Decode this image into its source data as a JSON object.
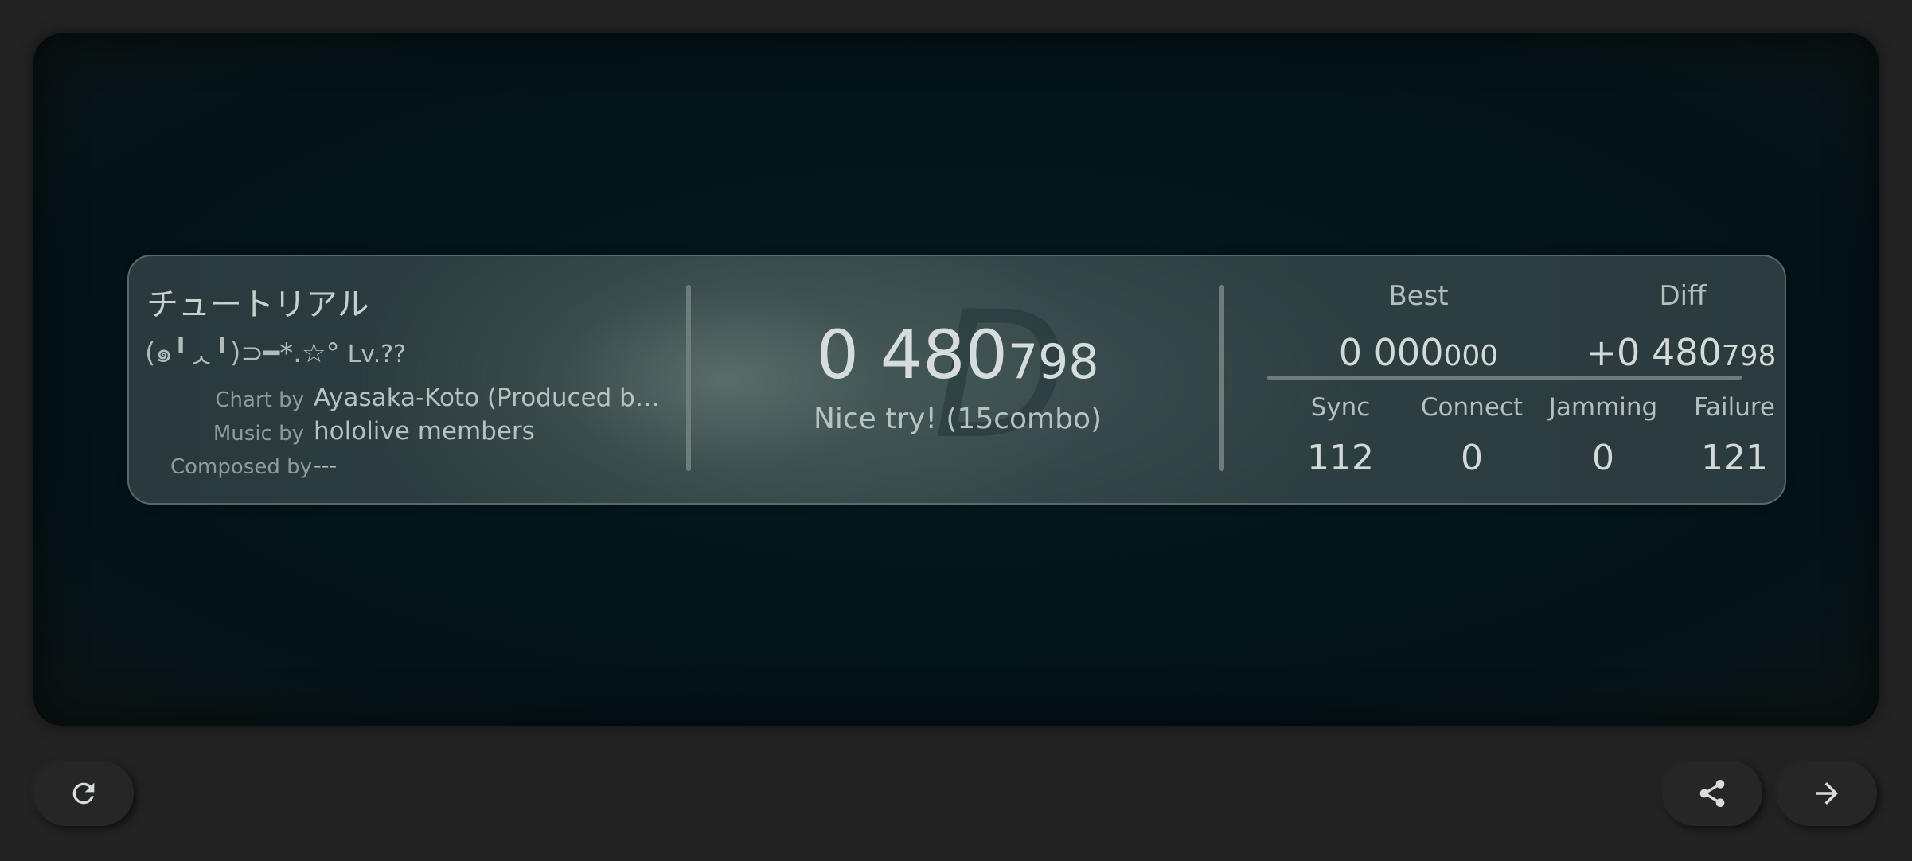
{
  "song": {
    "title": "チュートリアル",
    "artist": "(๑╹ᆺ╹)⊃━*.☆°",
    "level": "Lv.??"
  },
  "credits": [
    {
      "label": "Chart by",
      "value": "Ayasaka-Koto (Produced by ..."
    },
    {
      "label": "Music by",
      "value": "hololive members"
    },
    {
      "label": "Composed by",
      "value": "---"
    }
  ],
  "result": {
    "rank": "D",
    "score_big": "0 480",
    "score_small": "798",
    "message": "Nice try! (15combo)"
  },
  "best": {
    "label": "Best",
    "big": "0 000",
    "small": "000"
  },
  "diff": {
    "label": "Diff",
    "big": "+0 480",
    "small": "798"
  },
  "judgements": [
    {
      "label": "Sync",
      "value": "112"
    },
    {
      "label": "Connect",
      "value": "0"
    },
    {
      "label": "Jamming",
      "value": "0"
    },
    {
      "label": "Failure",
      "value": "121"
    }
  ],
  "buttons": {
    "retry_icon": "refresh-icon",
    "share_icon": "share-icon",
    "next_icon": "arrow-right-icon"
  },
  "colors": {
    "background": "#232323",
    "screen": "#02151a",
    "card": "#2f4143",
    "text": "#c9cfcf"
  }
}
